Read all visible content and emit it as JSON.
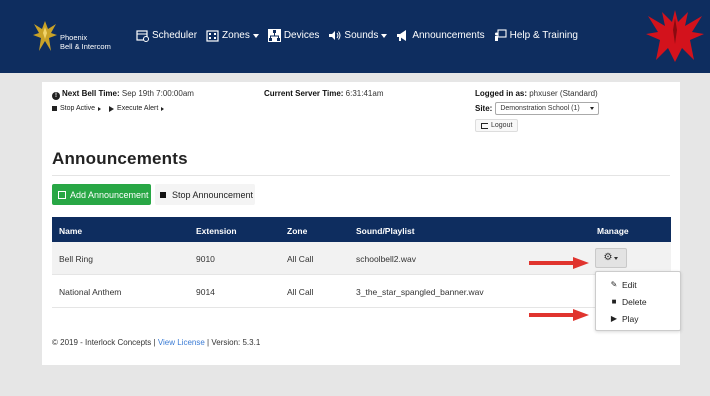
{
  "app": {
    "logo_line1": "Phoenix",
    "logo_line2": "Bell & Intercom"
  },
  "nav": {
    "items": [
      {
        "label": "Scheduler",
        "icon": "calendar-clock-icon",
        "dropdown": false
      },
      {
        "label": "Zones",
        "icon": "building-icon",
        "dropdown": true
      },
      {
        "label": "Devices",
        "icon": "network-icon",
        "dropdown": false
      },
      {
        "label": "Sounds",
        "icon": "speaker-icon",
        "dropdown": true
      },
      {
        "label": "Announcements",
        "icon": "megaphone-icon",
        "dropdown": false
      },
      {
        "label": "Help & Training",
        "icon": "person-board-icon",
        "dropdown": false
      }
    ]
  },
  "info": {
    "next_bell_label": "Next Bell Time:",
    "next_bell_value": "Sep 19th 7:00:00am",
    "stop_active": "Stop Active",
    "execute_alert": "Execute Alert",
    "server_time_label": "Current Server Time:",
    "server_time_value": "6:31:41am",
    "logged_in_label": "Logged in as:",
    "logged_in_value": "phxuser (Standard)",
    "site_label": "Site:",
    "site_value": "Demonstration School (1)",
    "logout": "Logout"
  },
  "page": {
    "title": "Announcements",
    "add_button": "Add Announcement",
    "stop_button": "Stop Announcement"
  },
  "table": {
    "headers": [
      "Name",
      "Extension",
      "Zone",
      "Sound/Playlist",
      "Manage"
    ],
    "rows": [
      {
        "name": "Bell Ring",
        "extension": "9010",
        "zone": "All Call",
        "sound": "schoolbell2.wav"
      },
      {
        "name": "National Anthem",
        "extension": "9014",
        "zone": "All Call",
        "sound": "3_the_star_spangled_banner.wav"
      }
    ]
  },
  "manage_menu": {
    "items": [
      "Edit",
      "Delete",
      "Play"
    ]
  },
  "footer": {
    "prefix": "© 2019 - Interlock Concepts |",
    "license_link": "View License",
    "version": "| Version: 5.3.1"
  },
  "colors": {
    "navbar": "#0e2d5f",
    "add_button": "#28a745",
    "arrow": "#e0342e",
    "phoenix": "#d3121c"
  }
}
